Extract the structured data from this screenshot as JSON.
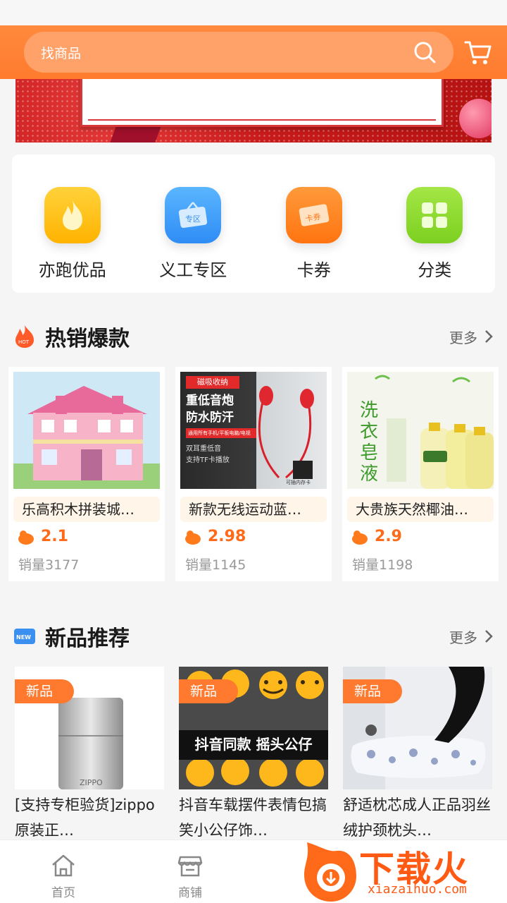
{
  "search": {
    "placeholder": "找商品"
  },
  "quick_nav": [
    {
      "label": "亦跑优品",
      "icon": "flame-icon",
      "color": "#ffc21a"
    },
    {
      "label": "义工专区",
      "icon": "zone-tag-icon",
      "color": "#3ea2ff"
    },
    {
      "label": "卡券",
      "icon": "coupon-icon",
      "color": "#ff8a1e"
    },
    {
      "label": "分类",
      "icon": "category-grid-icon",
      "color": "#8fdc2a"
    }
  ],
  "hot": {
    "title": "热销爆款",
    "more": "更多",
    "icon_text": "HOT",
    "products": [
      {
        "name": "乐高积木拼装城…",
        "price": "2.1",
        "sales": "销量3177"
      },
      {
        "name": "新款无线运动蓝…",
        "price": "2.98",
        "sales": "销量1145",
        "img_lines": [
          "磁吸收纳",
          "重低音炮",
          "防水防汗",
          "通用所有手机/平板电脑/电视",
          "双耳重低音",
          "支持TF卡播放",
          "可插内存卡"
        ]
      },
      {
        "name": "大贵族天然椰油…",
        "price": "2.9",
        "sales": "销量1198",
        "img_text": "洗衣皂液"
      }
    ]
  },
  "new": {
    "title": "新品推荐",
    "more": "更多",
    "icon_text": "NEW",
    "badge": "新品",
    "products": [
      {
        "title": "[支持专柜验货]zippo原装正…",
        "img_text": "ZIPPO"
      },
      {
        "title": "抖音车载摆件表情包搞笑小公仔饰…",
        "img_text": "抖音同款 摇头公仔"
      },
      {
        "title": "舒适枕芯成人正品羽丝绒护颈枕头…"
      }
    ]
  },
  "tabbar": [
    {
      "label": "首页",
      "icon": "home-icon"
    },
    {
      "label": "商铺",
      "icon": "shop-icon"
    }
  ],
  "watermark": {
    "text": "下载火",
    "sub": "xiazaihuo.com"
  }
}
